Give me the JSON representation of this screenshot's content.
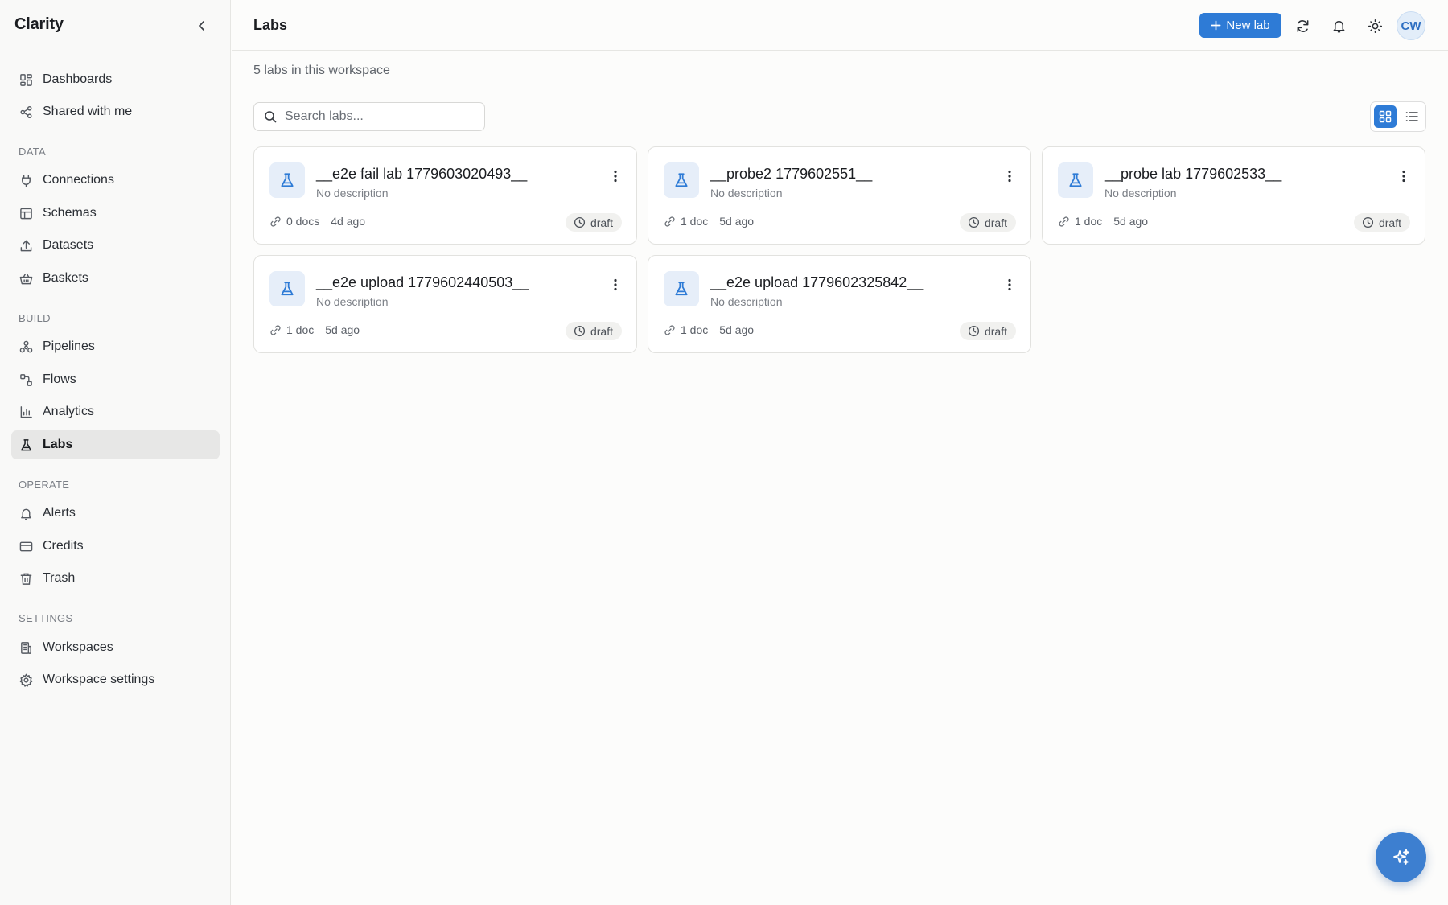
{
  "app": {
    "name": "Clarity"
  },
  "sidebar": {
    "top_items": [
      {
        "label": "Dashboards",
        "icon": "dashboard-icon"
      },
      {
        "label": "Shared with me",
        "icon": "share-icon"
      }
    ],
    "sections": {
      "data": {
        "label": "DATA",
        "items": [
          {
            "label": "Connections",
            "icon": "plug-icon"
          },
          {
            "label": "Schemas",
            "icon": "table-icon"
          },
          {
            "label": "Datasets",
            "icon": "upload-icon"
          },
          {
            "label": "Baskets",
            "icon": "basket-icon"
          }
        ]
      },
      "build": {
        "label": "BUILD",
        "items": [
          {
            "label": "Pipelines",
            "icon": "pipeline-icon"
          },
          {
            "label": "Flows",
            "icon": "flow-icon"
          },
          {
            "label": "Analytics",
            "icon": "bar-chart-icon"
          },
          {
            "label": "Labs",
            "icon": "flask-icon",
            "active": true
          }
        ]
      },
      "operate": {
        "label": "OPERATE",
        "items": [
          {
            "label": "Alerts",
            "icon": "bell-icon"
          },
          {
            "label": "Credits",
            "icon": "credit-card-icon"
          },
          {
            "label": "Trash",
            "icon": "trash-icon"
          }
        ]
      },
      "settings": {
        "label": "SETTINGS",
        "items": [
          {
            "label": "Workspaces",
            "icon": "building-icon"
          },
          {
            "label": "Workspace settings",
            "icon": "gear-icon"
          }
        ]
      }
    }
  },
  "header": {
    "title": "Labs",
    "new_button": "New lab",
    "avatar_initials": "CW"
  },
  "main": {
    "count_text": "5 labs in this workspace",
    "search_placeholder": "Search labs...",
    "view_mode": "grid",
    "cards": [
      {
        "title": "__e2e fail lab 1779603020493__",
        "description": "No description",
        "docs": "0 docs",
        "age": "4d ago",
        "status": "draft"
      },
      {
        "title": "__probe2 1779602551__",
        "description": "No description",
        "docs": "1 doc",
        "age": "5d ago",
        "status": "draft"
      },
      {
        "title": "__probe lab 1779602533__",
        "description": "No description",
        "docs": "1 doc",
        "age": "5d ago",
        "status": "draft"
      },
      {
        "title": "__e2e upload 1779602440503__",
        "description": "No description",
        "docs": "1 doc",
        "age": "5d ago",
        "status": "draft"
      },
      {
        "title": "__e2e upload 1779602325842__",
        "description": "No description",
        "docs": "1 doc",
        "age": "5d ago",
        "status": "draft"
      }
    ]
  },
  "colors": {
    "accent": "#2e7bd6",
    "active_nav_bg": "#e7e7e6",
    "card_icon_bg": "#e6eef9"
  }
}
